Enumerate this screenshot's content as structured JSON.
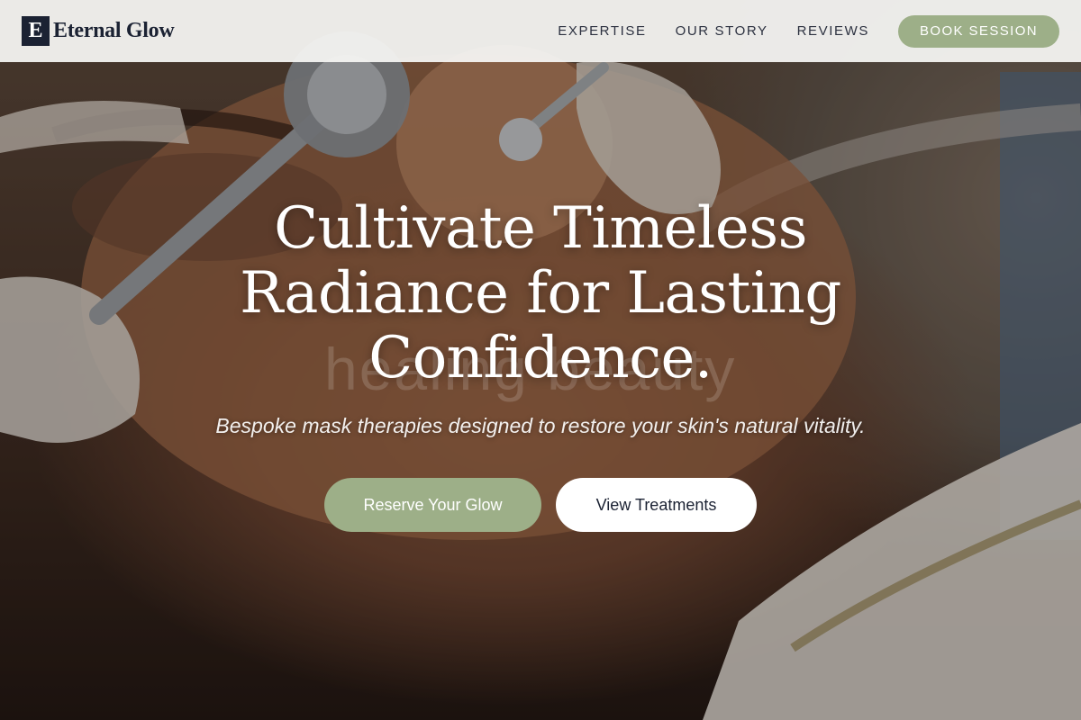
{
  "header": {
    "brand_mark": "E",
    "brand_name": "Eternal Glow",
    "nav": [
      {
        "label": "EXPERTISE"
      },
      {
        "label": "OUR STORY"
      },
      {
        "label": "REVIEWS"
      }
    ],
    "cta_label": "BOOK SESSION"
  },
  "hero": {
    "background_text": "healing beauty",
    "headline_lines": [
      "Cultivate Timeless",
      "Radiance for Lasting",
      "Confidence."
    ],
    "subheadline": "Bespoke mask therapies designed to restore your skin's natural vitality.",
    "primary_button": "Reserve Your Glow",
    "secondary_button": "View Treatments"
  },
  "colors": {
    "accent": "#9daf88",
    "navy": "#1b2233",
    "header_bg": "#f5f5f3",
    "white": "#ffffff"
  }
}
